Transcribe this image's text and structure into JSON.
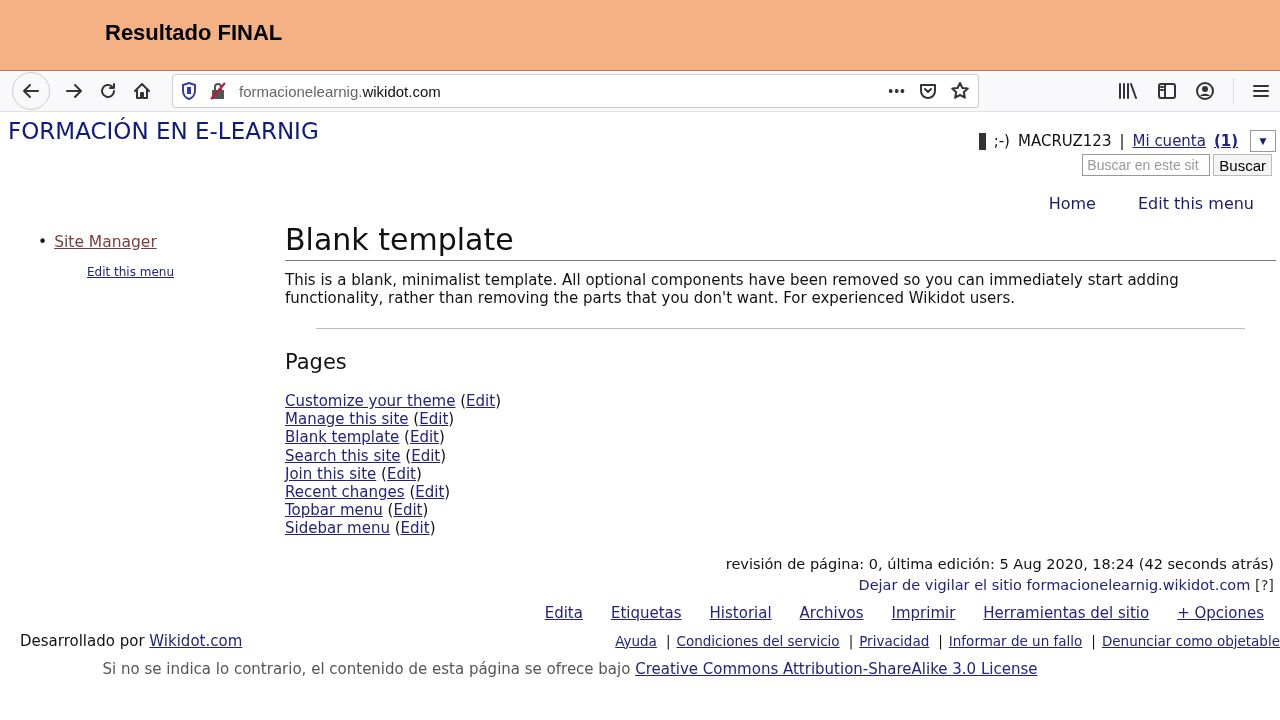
{
  "slide": {
    "title": "Resultado FINAL"
  },
  "browser": {
    "url_subdomain": "formacionelearnig.",
    "url_domain": "wikidot.com",
    "overflow_menu": "•••"
  },
  "site": {
    "title": "FORMACIÓN EN E-LEARNIG",
    "user": {
      "emote": ";-)",
      "name": "MACRUZ123",
      "separator": "|",
      "account_link": "Mi cuenta",
      "notifications": "(1)",
      "menu_toggle": "▼"
    },
    "search": {
      "placeholder": "Buscar en este sit",
      "button": "Buscar"
    },
    "top_menu": [
      "Home",
      "Edit this menu"
    ]
  },
  "sidebar": {
    "items": [
      {
        "bullet": "•",
        "label": "Site Manager"
      }
    ],
    "edit_link": "Edit this menu"
  },
  "content": {
    "title": "Blank template",
    "intro": "This is a blank, minimalist template. All optional components have been removed so you can immediately start adding functionality, rather than removing the parts that you don't want. For experienced Wikidot users.",
    "pages_heading": "Pages",
    "edit_brackets": {
      "open": "(",
      "close": ")"
    },
    "pages": [
      {
        "label": "Customize your theme",
        "edit": "Edit"
      },
      {
        "label": "Manage this site",
        "edit": "Edit"
      },
      {
        "label": "Blank template",
        "edit": "Edit"
      },
      {
        "label": "Search this site",
        "edit": "Edit"
      },
      {
        "label": "Join this site",
        "edit": "Edit"
      },
      {
        "label": "Recent changes",
        "edit": "Edit"
      },
      {
        "label": "Topbar menu",
        "edit": "Edit"
      },
      {
        "label": "Sidebar menu",
        "edit": "Edit"
      }
    ]
  },
  "page_info": {
    "revision": "revisión de página: 0, última edición: 5 Aug 2020, 18:24 (42 seconds atrás)",
    "watch_link": "Dejar de vigilar el sitio formacionelearnig.wikidot.com",
    "help_link": "[?]"
  },
  "page_options": [
    "Edita",
    "Etiquetas",
    "Historial",
    "Archivos",
    "Imprimir",
    "Herramientas del sitio",
    "+ Opciones"
  ],
  "footer": {
    "powered_by": "Desarrollado por",
    "powered_link": "Wikidot.com",
    "separator": "|",
    "links": [
      "Ayuda",
      "Condiciones del servicio",
      "Privacidad",
      "Informar de un fallo",
      "Denunciar como objetable"
    ],
    "license_text": "Si no se indica lo contrario, el contenido de esta página se ofrece bajo",
    "license_link": "Creative Commons Attribution-ShareAlike 3.0 License"
  }
}
